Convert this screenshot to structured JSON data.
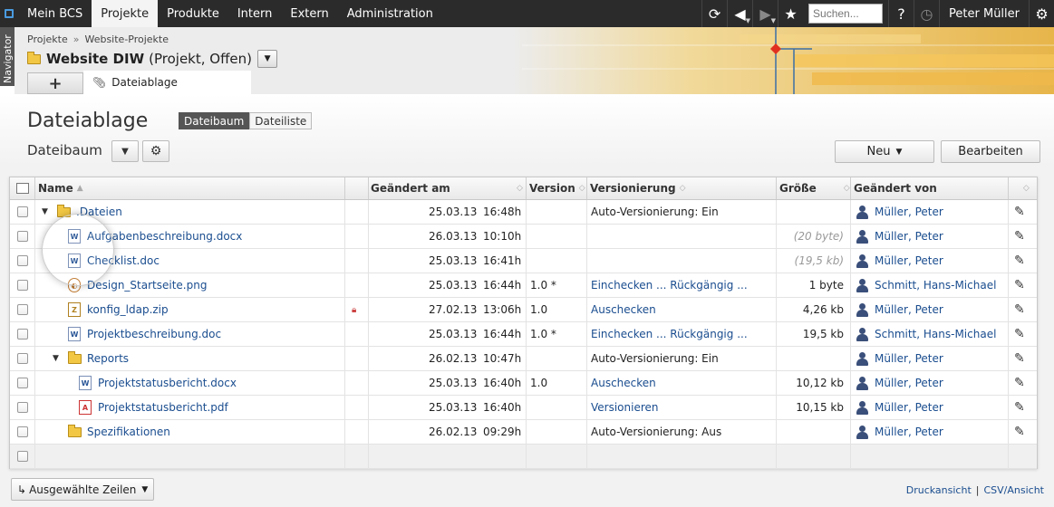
{
  "topnav": {
    "tabs": [
      "Mein BCS",
      "Projekte",
      "Produkte",
      "Intern",
      "Extern",
      "Administration"
    ],
    "active_tab": "Projekte",
    "search_placeholder": "Suchen...",
    "user": "Peter Müller",
    "icons": [
      "refresh-icon",
      "back-icon",
      "forward-icon",
      "star-icon",
      "help-icon",
      "timer-icon",
      "gear-icon"
    ]
  },
  "navigator": {
    "label": "Navigator"
  },
  "header": {
    "breadcrumb": [
      "Projekte",
      "Website-Projekte"
    ],
    "breadcrumb_sep": "»",
    "project_name": "Website DIW",
    "project_meta": "(Projekt, Offen)",
    "plus_label": "+",
    "tab_label": "Dateiablage"
  },
  "page": {
    "title": "Dateiablage",
    "view_toggle": [
      "Dateibaum",
      "Dateiliste"
    ],
    "active_view": "Dateibaum",
    "subtitle": "Dateibaum",
    "new_button": "Neu",
    "edit_button": "Bearbeiten"
  },
  "table": {
    "columns": [
      "Name",
      "Geändert am",
      "Version",
      "Versionierung",
      "Größe",
      "Geändert von"
    ],
    "rows": [
      {
        "indent": 0,
        "type": "folder",
        "expand": "▼",
        "name": ".Dateien",
        "date": "25.03.13",
        "time": "16:48h",
        "version": "",
        "versioning": "Auto-Versionierung: Ein",
        "versioning_link": false,
        "size": "",
        "size_muted": false,
        "user": "Müller, Peter",
        "lock": false
      },
      {
        "indent": 1,
        "type": "doc",
        "expand": "",
        "name": "Aufgabenbeschreibung.docx",
        "date": "26.03.13",
        "time": "10:10h",
        "version": "",
        "versioning": "",
        "versioning_link": false,
        "size": "(20 byte)",
        "size_muted": true,
        "user": "Müller, Peter",
        "lock": false
      },
      {
        "indent": 1,
        "type": "doc",
        "expand": "",
        "name": "Checklist.doc",
        "date": "25.03.13",
        "time": "16:41h",
        "version": "",
        "versioning": "",
        "versioning_link": false,
        "size": "(19,5 kb)",
        "size_muted": true,
        "user": "Müller, Peter",
        "lock": false
      },
      {
        "indent": 1,
        "type": "png",
        "expand": "",
        "name": "Design_Startseite.png",
        "date": "25.03.13",
        "time": "16:44h",
        "version": "1.0 *",
        "versioning": "Einchecken ... Rückgängig ...",
        "versioning_link": true,
        "size": "1 byte",
        "size_muted": false,
        "user": "Schmitt, Hans-Michael",
        "lock": false
      },
      {
        "indent": 1,
        "type": "zip",
        "expand": "",
        "name": "konfig_ldap.zip",
        "date": "27.02.13",
        "time": "13:06h",
        "version": "1.0",
        "versioning": "Auschecken",
        "versioning_link": true,
        "size": "4,26 kb",
        "size_muted": false,
        "user": "Müller, Peter",
        "lock": true
      },
      {
        "indent": 1,
        "type": "doc",
        "expand": "",
        "name": "Projektbeschreibung.doc",
        "date": "25.03.13",
        "time": "16:44h",
        "version": "1.0 *",
        "versioning": "Einchecken ... Rückgängig ...",
        "versioning_link": true,
        "size": "19,5 kb",
        "size_muted": false,
        "user": "Schmitt, Hans-Michael",
        "lock": false
      },
      {
        "indent": 1,
        "type": "folder",
        "expand": "▼",
        "name": "Reports",
        "date": "26.02.13",
        "time": "10:47h",
        "version": "",
        "versioning": "Auto-Versionierung: Ein",
        "versioning_link": false,
        "size": "",
        "size_muted": false,
        "user": "Müller, Peter",
        "lock": false
      },
      {
        "indent": 2,
        "type": "doc",
        "expand": "",
        "name": "Projektstatusbericht.docx",
        "date": "25.03.13",
        "time": "16:40h",
        "version": "1.0",
        "versioning": "Auschecken",
        "versioning_link": true,
        "size": "10,12 kb",
        "size_muted": false,
        "user": "Müller, Peter",
        "lock": false
      },
      {
        "indent": 2,
        "type": "pdf",
        "expand": "",
        "name": "Projektstatusbericht.pdf",
        "date": "25.03.13",
        "time": "16:40h",
        "version": "",
        "versioning": "Versionieren",
        "versioning_link": true,
        "size": "10,15 kb",
        "size_muted": false,
        "user": "Müller, Peter",
        "lock": false
      },
      {
        "indent": 1,
        "type": "folder",
        "expand": "",
        "name": "Spezifikationen",
        "date": "26.02.13",
        "time": "09:29h",
        "version": "",
        "versioning": "Auto-Versionierung: Aus",
        "versioning_link": false,
        "size": "",
        "size_muted": false,
        "user": "Müller, Peter",
        "lock": false
      }
    ]
  },
  "footer": {
    "selected_rows_button": "Ausgewählte Zeilen",
    "links": [
      "Druckansicht",
      "CSV/Ansicht"
    ],
    "link_sep": "|"
  },
  "colors": {
    "topnav_bg": "#2b2b2b",
    "link": "#1a4d8f",
    "active_toggle": "#555555",
    "header_accent": "#e7b54a"
  }
}
